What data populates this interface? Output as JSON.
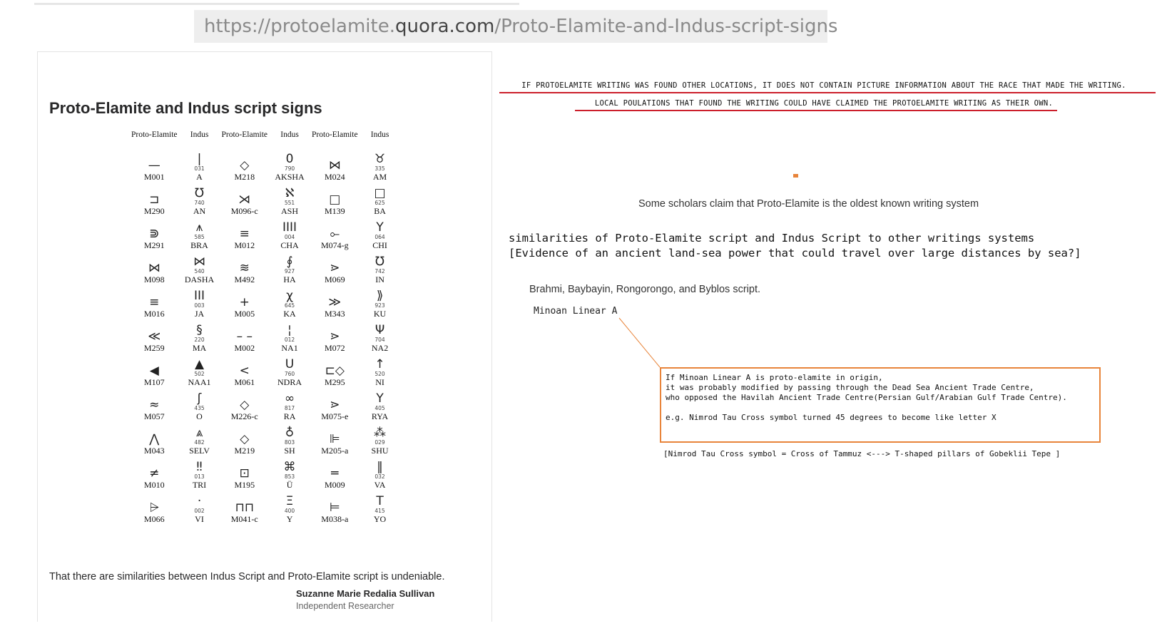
{
  "url": {
    "prefix": "https://protoelamite.",
    "domain": "quora.com",
    "path": "/Proto-Elamite-and-Indus-script-signs"
  },
  "card": {
    "title": "Proto-Elamite and Indus script signs",
    "headers": [
      "Proto-Elamite",
      "Indus",
      "Proto-Elamite",
      "Indus",
      "Proto-Elamite",
      "Indus"
    ],
    "rows": [
      [
        [
          "—",
          "",
          "M001"
        ],
        [
          "|",
          "031",
          "A"
        ],
        [
          "◇",
          "",
          "M218"
        ],
        [
          "0",
          "790",
          "AKSHA"
        ],
        [
          "⋈",
          "",
          "M024"
        ],
        [
          "♉",
          "335",
          "AM"
        ]
      ],
      [
        [
          "⊐",
          "",
          "M290"
        ],
        [
          "℧",
          "740",
          "AN"
        ],
        [
          "⋊",
          "",
          "M096-c"
        ],
        [
          "ℵ",
          "551",
          "ASH"
        ],
        [
          "□",
          "",
          "M139"
        ],
        [
          "□",
          "625",
          "BA"
        ]
      ],
      [
        [
          "⋑",
          "",
          "M291"
        ],
        [
          "⩚",
          "585",
          "BRA"
        ],
        [
          "≡",
          "",
          "M012"
        ],
        [
          "IIII",
          "004",
          "CHA"
        ],
        [
          "⟜",
          "",
          "M074-g"
        ],
        [
          "Y",
          "064",
          "CHI"
        ]
      ],
      [
        [
          "⋈",
          "",
          "M098"
        ],
        [
          "⋈",
          "540",
          "DASHA"
        ],
        [
          "≋",
          "",
          "M492"
        ],
        [
          "∮",
          "927",
          "HA"
        ],
        [
          "⋗",
          "",
          "M069"
        ],
        [
          "℧",
          "742",
          "IN"
        ]
      ],
      [
        [
          "≡",
          "",
          "M016"
        ],
        [
          "III",
          "003",
          "JA"
        ],
        [
          "+",
          "",
          "M005"
        ],
        [
          "χ",
          "645",
          "KA"
        ],
        [
          "≫",
          "",
          "M343"
        ],
        [
          "⟫",
          "923",
          "KU"
        ]
      ],
      [
        [
          "≪",
          "",
          "M259"
        ],
        [
          "§",
          "220",
          "MA"
        ],
        [
          "– –",
          "",
          "M002"
        ],
        [
          "¦",
          "012",
          "NA1"
        ],
        [
          "⋗",
          "",
          "M072"
        ],
        [
          "Ψ",
          "704",
          "NA2"
        ]
      ],
      [
        [
          "◀",
          "",
          "M107"
        ],
        [
          "▲",
          "502",
          "NAA1"
        ],
        [
          "<",
          "",
          "M061"
        ],
        [
          "U",
          "760",
          "NDRA"
        ],
        [
          "⊏◇",
          "",
          "M295"
        ],
        [
          "↑",
          "520",
          "NI"
        ]
      ],
      [
        [
          "≈",
          "",
          "M057"
        ],
        [
          "ʃ",
          "435",
          "O"
        ],
        [
          "◇",
          "",
          "M226-c"
        ],
        [
          "∞",
          "817",
          "RA"
        ],
        [
          "⋗",
          "",
          "M075-e"
        ],
        [
          "Y",
          "405",
          "RYA"
        ]
      ],
      [
        [
          "⋀",
          "",
          "M043"
        ],
        [
          "⩓",
          "482",
          "SELV"
        ],
        [
          "◇",
          "",
          "M219"
        ],
        [
          "♁",
          "803",
          "SH"
        ],
        [
          "⊫",
          "",
          "M205-a"
        ],
        [
          "⁂",
          "029",
          "SHU"
        ]
      ],
      [
        [
          "≠",
          "",
          "M010"
        ],
        [
          "‼",
          "013",
          "TRI"
        ],
        [
          "⊡",
          "",
          "M195"
        ],
        [
          "⌘",
          "853",
          "Ü"
        ],
        [
          "═",
          "",
          "M009"
        ],
        [
          "‖",
          "032",
          "VA"
        ]
      ],
      [
        [
          "⩥",
          "",
          "M066"
        ],
        [
          "·",
          "002",
          "VI"
        ],
        [
          "⊓⊓",
          "",
          "M041-c"
        ],
        [
          "Ξ",
          "400",
          "Y"
        ],
        [
          "⊨",
          "",
          "M038-a"
        ],
        [
          "T",
          "415",
          "YO"
        ]
      ]
    ],
    "caption": "That there are similarities between Indus Script and Proto-Elamite script is undeniable.",
    "author": "Suzanne Marie Redalia Sullivan",
    "author_role": "Independent Researcher"
  },
  "notes": {
    "red_line_1": "IF PROTOELAMITE WRITING WAS FOUND OTHER LOCATIONS, IT DOES NOT CONTAIN PICTURE INFORMATION ABOUT THE RACE THAT MADE THE WRITING.",
    "red_line_2": "LOCAL POULATIONS THAT FOUND THE WRITING COULD HAVE CLAIMED THE PROTOELAMITE WRITING AS THEIR OWN.",
    "scholars": "Some scholars claim that Proto-Elamite is the oldest known writing system",
    "similarities_1": "similarities of Proto-Elamite script and Indus Script to other writings systems",
    "similarities_2": "[Evidence of an ancient land-sea power that could travel over large distances by sea?]",
    "scripts": "Brahmi, Baybayin, Rongorongo, and Byblos script.",
    "minoan": "Minoan Linear A",
    "box_lines": [
      "If Minoan Linear A is proto-elamite in origin,",
      "it was probably modified by passing through the Dead Sea Ancient Trade Centre,",
      "who opposed the Havilah Ancient Trade Centre(Persian Gulf/Arabian Gulf Trade Centre).",
      "",
      "e.g. Nimrod Tau Cross symbol turned 45 degrees to become like letter X"
    ],
    "nimrod": "[Nimrod Tau Cross symbol = Cross of Tammuz <---> T-shaped pillars of Gobeklii Tepe ]"
  },
  "colors": {
    "underline_red": "#cc1f2b",
    "box_orange": "#e8843a"
  }
}
